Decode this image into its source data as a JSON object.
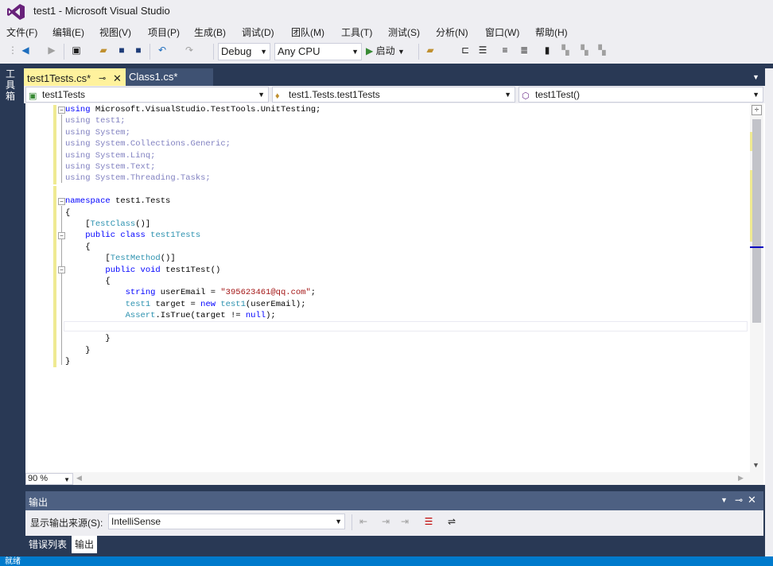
{
  "window": {
    "title": "test1 - Microsoft Visual Studio"
  },
  "menu": [
    {
      "label": "文件(F)"
    },
    {
      "label": "编辑(E)"
    },
    {
      "label": "视图(V)"
    },
    {
      "label": "项目(P)"
    },
    {
      "label": "生成(B)"
    },
    {
      "label": "调试(D)"
    },
    {
      "label": "团队(M)"
    },
    {
      "label": "工具(T)"
    },
    {
      "label": "测试(S)"
    },
    {
      "label": "分析(N)"
    },
    {
      "label": "窗口(W)"
    },
    {
      "label": "帮助(H)"
    }
  ],
  "toolbar": {
    "config": "Debug",
    "platform": "Any CPU",
    "start_label": "启动"
  },
  "left_tab": {
    "label": "工具箱"
  },
  "tabs": [
    {
      "label": "test1Tests.cs*",
      "active": true
    },
    {
      "label": "Class1.cs*",
      "active": false
    }
  ],
  "nav": {
    "project": "test1Tests",
    "type": "test1.Tests.test1Tests",
    "member": "test1Test()"
  },
  "code_lines": [
    [
      {
        "t": "using ",
        "c": "kw"
      },
      {
        "t": "Microsoft.VisualStudio.TestTools.UnitTesting;",
        "c": ""
      }
    ],
    [
      {
        "t": "using test1;",
        "c": "gr"
      }
    ],
    [
      {
        "t": "using System;",
        "c": "gr"
      }
    ],
    [
      {
        "t": "using System.Collections.Generic;",
        "c": "gr"
      }
    ],
    [
      {
        "t": "using System.Linq;",
        "c": "gr"
      }
    ],
    [
      {
        "t": "using System.Text;",
        "c": "gr"
      }
    ],
    [
      {
        "t": "using System.Threading.Tasks;",
        "c": "gr"
      }
    ],
    [
      {
        "t": "",
        "c": ""
      }
    ],
    [
      {
        "t": "namespace ",
        "c": "kw"
      },
      {
        "t": "test1.Tests",
        "c": ""
      }
    ],
    [
      {
        "t": "{",
        "c": ""
      }
    ],
    [
      {
        "t": "    [",
        "c": ""
      },
      {
        "t": "TestClass",
        "c": "ty"
      },
      {
        "t": "()]",
        "c": ""
      }
    ],
    [
      {
        "t": "    ",
        "c": ""
      },
      {
        "t": "public class ",
        "c": "kw"
      },
      {
        "t": "test1Tests",
        "c": "ty"
      }
    ],
    [
      {
        "t": "    {",
        "c": ""
      }
    ],
    [
      {
        "t": "        [",
        "c": ""
      },
      {
        "t": "TestMethod",
        "c": "ty"
      },
      {
        "t": "()]",
        "c": ""
      }
    ],
    [
      {
        "t": "        ",
        "c": ""
      },
      {
        "t": "public void ",
        "c": "kw"
      },
      {
        "t": "test1Test()",
        "c": ""
      }
    ],
    [
      {
        "t": "        {",
        "c": ""
      }
    ],
    [
      {
        "t": "            ",
        "c": ""
      },
      {
        "t": "string ",
        "c": "kw"
      },
      {
        "t": "userEmail = ",
        "c": ""
      },
      {
        "t": "\"395623461@qq.com\"",
        "c": "st"
      },
      {
        "t": ";",
        "c": ""
      }
    ],
    [
      {
        "t": "            ",
        "c": ""
      },
      {
        "t": "test1 ",
        "c": "ty"
      },
      {
        "t": "target = ",
        "c": ""
      },
      {
        "t": "new ",
        "c": "kw"
      },
      {
        "t": "test1",
        "c": "ty"
      },
      {
        "t": "(userEmail);",
        "c": ""
      }
    ],
    [
      {
        "t": "            ",
        "c": ""
      },
      {
        "t": "Assert",
        "c": "ty"
      },
      {
        "t": ".IsTrue(target != ",
        "c": ""
      },
      {
        "t": "null",
        "c": "kw"
      },
      {
        "t": ");",
        "c": ""
      }
    ],
    [
      {
        "t": "",
        "c": ""
      }
    ],
    [
      {
        "t": "        }",
        "c": ""
      }
    ],
    [
      {
        "t": "    }",
        "c": ""
      }
    ],
    [
      {
        "t": "}",
        "c": ""
      }
    ]
  ],
  "editor": {
    "zoom": "90 %"
  },
  "output": {
    "title": "输出",
    "source_label": "显示输出来源(S):",
    "source_value": "IntelliSense"
  },
  "bottom_tabs": [
    {
      "label": "错误列表",
      "active": false
    },
    {
      "label": "输出",
      "active": true
    }
  ],
  "status": {
    "text": "就绪"
  }
}
